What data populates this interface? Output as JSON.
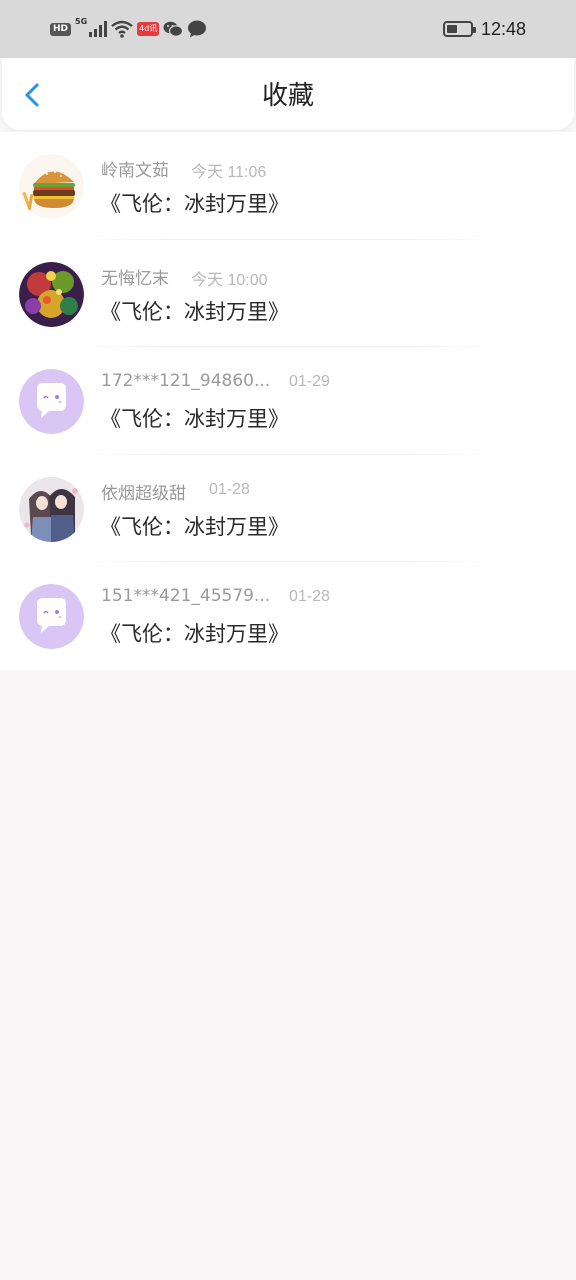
{
  "status_bar": {
    "hd": "HD",
    "network": "5G",
    "red_icon_text": "4d讯",
    "time": "12:48",
    "battery_level": 0.45
  },
  "header": {
    "title": "收藏",
    "accent_color": "#2196e8"
  },
  "favorites": [
    {
      "user": "岭南文茹",
      "time": "今天 11:06",
      "book": "《飞伦：冰封万里》",
      "avatar": "burger-avatar"
    },
    {
      "user": "无悔忆末",
      "time": "今天 10:00",
      "book": "《飞伦：冰封万里》",
      "avatar": "game-art-avatar"
    },
    {
      "user": "172***121_94860...",
      "time": "01-29",
      "book": "《飞伦：冰封万里》",
      "avatar": "default-chat-avatar"
    },
    {
      "user": "依烟超级甜",
      "time": "01-28",
      "book": "《飞伦：冰封万里》",
      "avatar": "anime-couple-avatar"
    },
    {
      "user": "151***421_45579...",
      "time": "01-28",
      "book": "《飞伦：冰封万里》",
      "avatar": "default-chat-avatar"
    }
  ]
}
